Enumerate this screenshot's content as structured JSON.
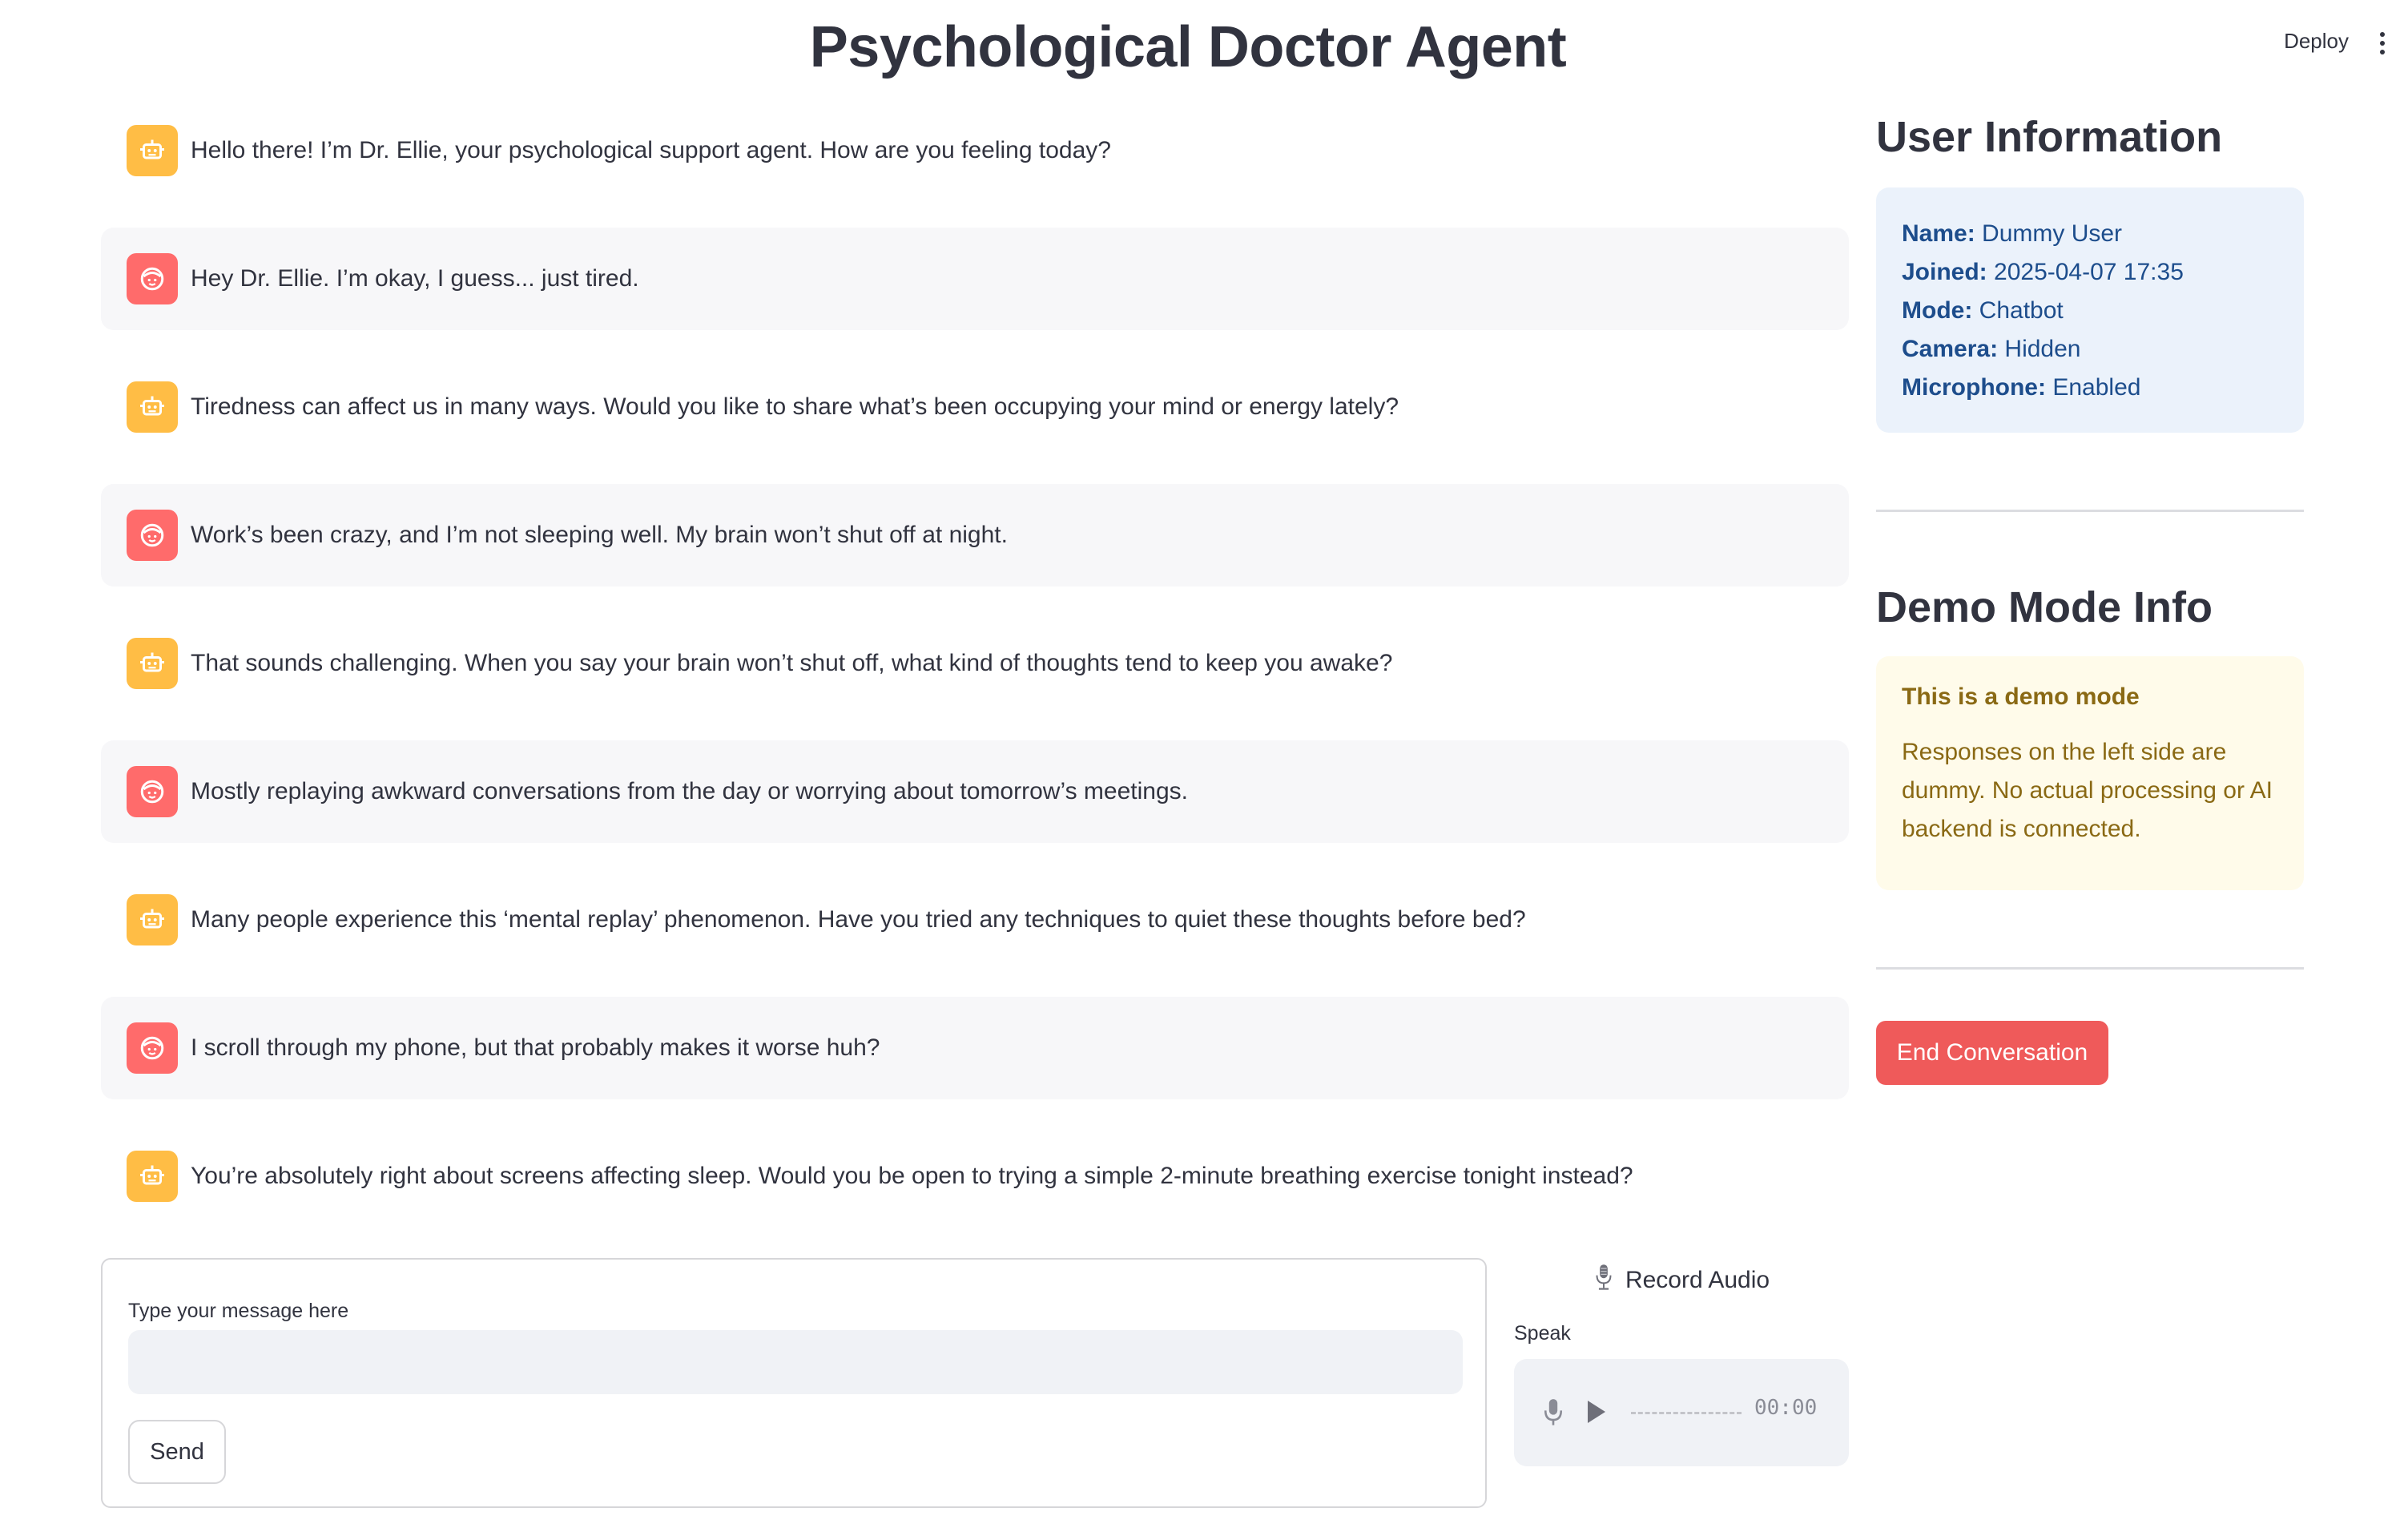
{
  "header": {
    "title": "Psychological Doctor Agent",
    "deploy_label": "Deploy",
    "menu_icon": "kebab-menu-icon"
  },
  "chat": {
    "messages": [
      {
        "role": "assistant",
        "text": "Hello there! I’m Dr. Ellie, your psychological support agent. How are you feeling today?"
      },
      {
        "role": "user",
        "text": "Hey Dr. Ellie. I’m okay, I guess... just tired."
      },
      {
        "role": "assistant",
        "text": "Tiredness can affect us in many ways. Would you like to share what’s been occupying your mind or energy lately?"
      },
      {
        "role": "user",
        "text": "Work’s been crazy, and I’m not sleeping well. My brain won’t shut off at night."
      },
      {
        "role": "assistant",
        "text": "That sounds challenging. When you say your brain won’t shut off, what kind of thoughts tend to keep you awake?"
      },
      {
        "role": "user",
        "text": "Mostly replaying awkward conversations from the day or worrying about tomorrow’s meetings."
      },
      {
        "role": "assistant",
        "text": "Many people experience this ‘mental replay’ phenomenon. Have you tried any techniques to quiet these thoughts before bed?"
      },
      {
        "role": "user",
        "text": "I scroll through my phone, but that probably makes it worse huh?"
      },
      {
        "role": "assistant",
        "text": "You’re absolutely right about screens affecting sleep. Would you be open to trying a simple 2-minute breathing exercise tonight instead?"
      }
    ],
    "assistant_icon": "robot-face-icon",
    "user_icon": "user-face-icon"
  },
  "composer": {
    "label": "Type your message here",
    "value": "",
    "send_label": "Send"
  },
  "audio": {
    "header_label": "Record Audio",
    "header_icon": "studio-microphone-icon",
    "speak_label": "Speak",
    "time": "00:00"
  },
  "sidebar": {
    "user_info": {
      "heading": "User Information",
      "fields": [
        {
          "label": "Name:",
          "value": "Dummy User"
        },
        {
          "label": "Joined:",
          "value": "2025-04-07 17:35"
        },
        {
          "label": "Mode:",
          "value": "Chatbot"
        },
        {
          "label": "Camera:",
          "value": "Hidden"
        },
        {
          "label": "Microphone:",
          "value": "Enabled"
        }
      ]
    },
    "demo": {
      "heading": "Demo Mode Info",
      "title": "This is a demo mode",
      "text": "Responses on the left side are dummy. No actual processing or AI backend is connected."
    },
    "end_label": "End Conversation"
  },
  "colors": {
    "assistant_avatar": "#ffbd45",
    "user_avatar": "#ff6b6b",
    "info_bg": "#ebf2fb",
    "info_text": "#1d4d8c",
    "warning_bg": "#fffbea",
    "warning_text": "#8a6914",
    "danger": "#ef5a5a"
  }
}
